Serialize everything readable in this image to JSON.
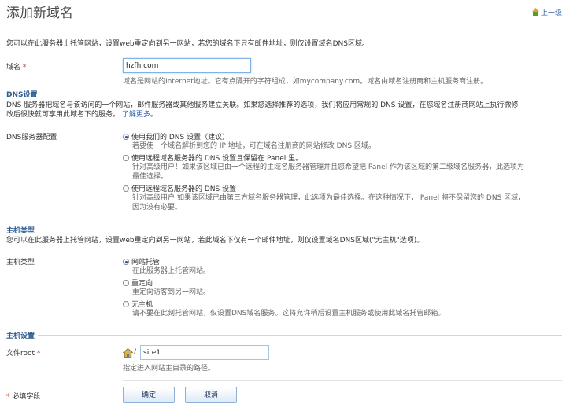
{
  "header": {
    "title": "添加新域名",
    "up_link": "上一级"
  },
  "intro": "您可以在此服务器上托管网站，设置web重定向到另一网站，若您的域名下只有邮件地址，则仅设置域名DNS区域。",
  "domain": {
    "label": "域名",
    "required_mark": "*",
    "value": "hzfh.com",
    "hint": "域名是网站的Internet地址。它有点隔开的字符组成，如mycompany.com。域名由域名注册商和主机服务商注册。"
  },
  "dns": {
    "section_title": "DNS设置",
    "desc_line1": "DNS 服务器把域名与该访问的一个网站，邮件服务器或其他服务建立关联。如果您选择推荐的选项，我们将应用常规的 DNS 设置，在您域名注册商网站上执行微修",
    "desc_line2": "改后很快就可享用此域名下的服务。",
    "learn_more": "了解更多。",
    "field_label": "DNS服务器配置",
    "options": [
      {
        "label": "使用我们的 DNS 设置（建议）",
        "sub": [
          "若要使一个域名解析到您的 IP 地址，可在域名注册商的网站修改 DNS 区域。"
        ],
        "checked": true
      },
      {
        "label": "使用远程域名服务器的 DNS 设置且保留在 Panel 里。",
        "sub": [
          "针对高级用户！如果该区域已由一个远程的主域名服务器管理并且您希望把 Panel 作为该区域的第二级域名服务器，此选项为",
          "最佳选择。"
        ],
        "checked": false
      },
      {
        "label": "使用远程域名服务器的 DNS 设置",
        "sub": [
          "针对高级用户:如果该区域已由第三方域名服务器管理，此选项为最佳选择。在这种情况下， Panel 将不保留您的 DNS 区域，",
          "因为没有必要。"
        ],
        "checked": false
      }
    ]
  },
  "host_type": {
    "section_title": "主机类型",
    "desc": "您可以在此服务器上托管网站，设置web重定向到另一网站，若此域名下仅有一个邮件地址，则仅设置域名DNS区域(\"无主机\"选项)。",
    "field_label": "主机类型",
    "options": [
      {
        "label": "网站托管",
        "sub": "在此服务器上托管网站。",
        "checked": true
      },
      {
        "label": "重定向",
        "sub": "重定向访客到另一网站。",
        "checked": false
      },
      {
        "label": "无主机",
        "sub": "请不要在此刻托管网站，仅设置DNS域名服务。这将允许稍后设置主机服务或使用此域名托管邮箱。",
        "checked": false
      }
    ]
  },
  "host_settings": {
    "section_title": "主机设置",
    "docroot_label": "文件root",
    "required_mark": "*",
    "slash": "/",
    "docroot_value": "site1",
    "docroot_hint": "指定进入网站主目录的路径。"
  },
  "footer": {
    "required_note": "必填字段",
    "required_mark": "*",
    "ok_label": "确定",
    "cancel_label": "取消"
  },
  "colors": {
    "section_title": "#2e5b8f",
    "required": "#d0281d",
    "link": "#2a5db0"
  }
}
